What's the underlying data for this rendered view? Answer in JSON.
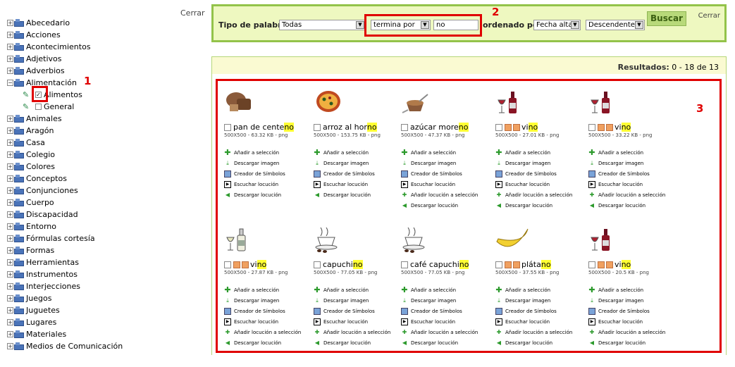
{
  "sidebar": {
    "close_label": "Cerrar",
    "items": [
      {
        "label": "Abecedario",
        "expander": "+"
      },
      {
        "label": "Acciones",
        "expander": "+"
      },
      {
        "label": "Acontecimientos",
        "expander": "+"
      },
      {
        "label": "Adjetivos",
        "expander": "+"
      },
      {
        "label": "Adverbios",
        "expander": "+"
      },
      {
        "label": "Alimentación",
        "expander": "−"
      },
      {
        "label": "Animales",
        "expander": "+"
      },
      {
        "label": "Aragón",
        "expander": "+"
      },
      {
        "label": "Casa",
        "expander": "+"
      },
      {
        "label": "Colegio",
        "expander": "+"
      },
      {
        "label": "Colores",
        "expander": "+"
      },
      {
        "label": "Conceptos",
        "expander": "+"
      },
      {
        "label": "Conjunciones",
        "expander": "+"
      },
      {
        "label": "Cuerpo",
        "expander": "+"
      },
      {
        "label": "Discapacidad",
        "expander": "+"
      },
      {
        "label": "Entorno",
        "expander": "+"
      },
      {
        "label": "Fórmulas cortesía",
        "expander": "+"
      },
      {
        "label": "Formas",
        "expander": "+"
      },
      {
        "label": "Herramientas",
        "expander": "+"
      },
      {
        "label": "Instrumentos",
        "expander": "+"
      },
      {
        "label": "Interjecciones",
        "expander": "+"
      },
      {
        "label": "Juegos",
        "expander": "+"
      },
      {
        "label": "Juguetes",
        "expander": "+"
      },
      {
        "label": "Lugares",
        "expander": "+"
      },
      {
        "label": "Materiales",
        "expander": "+"
      },
      {
        "label": "Medios de Comunicación",
        "expander": "+"
      }
    ],
    "subitems": [
      {
        "label": "Alimentos",
        "checked": true
      },
      {
        "label": "General",
        "checked": false
      }
    ]
  },
  "markers": {
    "one": "1",
    "two": "2",
    "three": "3"
  },
  "search": {
    "word_type_label": "Tipo de palabra:",
    "word_type_value": "Todas",
    "match_value": "termina por",
    "query_value": "no",
    "order_label": "ordenado por",
    "order_value": "Fecha alta",
    "direction_value": "Descendente",
    "button_label": "Buscar",
    "close_label": "Cerrar"
  },
  "results": {
    "label": "Resultados:",
    "range": "0 - 18 de 13",
    "actions": [
      "Añadir a selección",
      "Descargar imagen",
      "Creador de Símbolos",
      "Escuchar locución",
      "Añadir locución a selección",
      "Descargar locución"
    ],
    "cards": [
      {
        "pre": "pan de cente",
        "hl": "no",
        "meta": "500X500 - 63.32 KB - png",
        "flags": false,
        "pic": "bread-picture",
        "actions": [
          0,
          1,
          2,
          3,
          5
        ]
      },
      {
        "pre": "arroz al hor",
        "hl": "no",
        "meta": "500X500 - 153.75 KB - png",
        "flags": false,
        "pic": "paella-picture",
        "actions": [
          0,
          1,
          2,
          3,
          5
        ]
      },
      {
        "pre": "azúcar more",
        "hl": "no",
        "meta": "500X500 - 47.37 KB - png",
        "flags": false,
        "pic": "sugar-picture",
        "actions": [
          0,
          1,
          2,
          3,
          4,
          5
        ]
      },
      {
        "pre": "vi",
        "hl": "no",
        "meta": "500X500 - 27.01 KB - png",
        "flags": true,
        "pic": "wine-picture",
        "actions": [
          0,
          1,
          2,
          3,
          4,
          5
        ]
      },
      {
        "pre": "vi",
        "hl": "no",
        "meta": "500X500 - 33.22 KB - png",
        "flags": true,
        "pic": "wine-picture",
        "actions": [
          0,
          1,
          2,
          3,
          4,
          5
        ]
      },
      {
        "pre": "vi",
        "hl": "no",
        "meta": "500X500 - 27.87 KB - png",
        "flags": true,
        "pic": "white-wine-picture",
        "actions": [
          0,
          1,
          2,
          3,
          4,
          5
        ]
      },
      {
        "pre": "capuchi",
        "hl": "no",
        "meta": "500X500 - 77.05 KB - png",
        "flags": false,
        "pic": "coffee-picture",
        "actions": [
          0,
          1,
          2,
          3,
          4,
          5
        ]
      },
      {
        "pre": "café capuchi",
        "hl": "no",
        "meta": "500X500 - 77.05 KB - png",
        "flags": false,
        "pic": "coffee-picture",
        "actions": [
          0,
          1,
          2,
          3,
          4,
          5
        ]
      },
      {
        "pre": "pláta",
        "hl": "no",
        "meta": "500X500 - 37.55 KB - png",
        "flags": true,
        "pic": "banana-picture",
        "actions": [
          0,
          1,
          2,
          3,
          4,
          5
        ]
      },
      {
        "pre": "vi",
        "hl": "no",
        "meta": "500X500 - 20.5 KB - png",
        "flags": true,
        "pic": "wine-picture",
        "actions": [
          0,
          1,
          2,
          3,
          4,
          5
        ]
      }
    ]
  }
}
